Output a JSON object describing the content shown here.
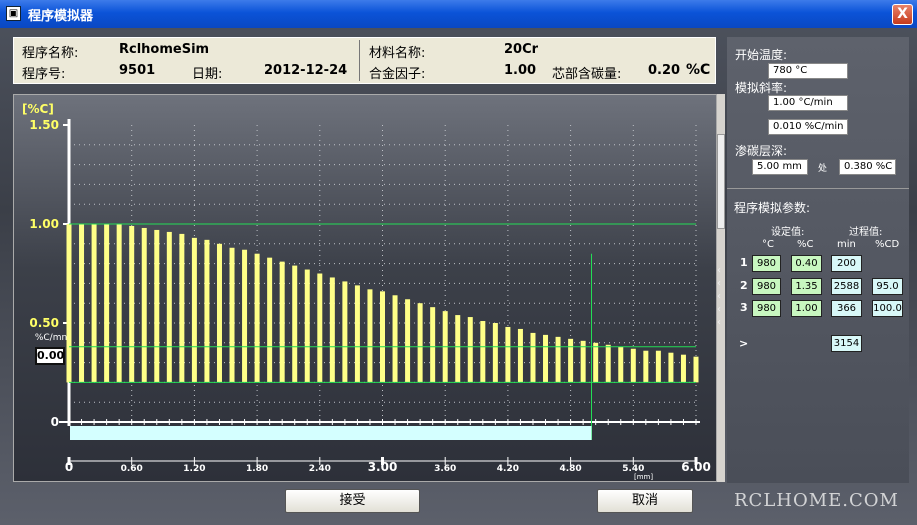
{
  "window": {
    "title": "程序模拟器",
    "close_label": "X",
    "icon_glyph": "▣"
  },
  "info": {
    "program_name_label": "程序名称:",
    "program_name": "RclhomeSim",
    "program_no_label": "程序号:",
    "program_no": "9501",
    "date_label": "日期:",
    "date": "2012-12-24",
    "material_label": "材料名称:",
    "material": "20Cr",
    "alloy_factor_label": "合金因子:",
    "alloy_factor": "1.00",
    "core_carbon_label": "芯部含碳量:",
    "core_carbon": "0.20",
    "core_carbon_unit": "%C"
  },
  "chart_rate": {
    "unit": "%C/mn",
    "value": "0.00"
  },
  "right_panel": {
    "start_temp_label": "开始温度:",
    "start_temp": "780 °C",
    "sim_slope_label": "模拟斜率:",
    "slope_temp": "1.00 °C/min",
    "slope_carbon": "0.010 %C/min",
    "case_depth_label": "渗碳层深:",
    "case_depth": "5.00 mm",
    "at_label": "处",
    "case_carbon": "0.380 %C",
    "params_title": "程序模拟参数:",
    "set_label": "设定值:",
    "proc_label": "过程值:",
    "col_c": "°C",
    "col_pc": "%C",
    "col_min": "min",
    "col_pcd": "%CD",
    "rows": [
      {
        "n": "1",
        "temp": "980",
        "carbon": "0.40",
        "min": "200",
        "cd": ""
      },
      {
        "n": "2",
        "temp": "980",
        "carbon": "1.35",
        "min": "2588",
        "cd": "95.0"
      },
      {
        "n": "3",
        "temp": "980",
        "carbon": "1.00",
        "min": "366",
        "cd": "100.0"
      }
    ],
    "total_arrow": ">",
    "total_min": "3154"
  },
  "buttons": {
    "accept": "接受",
    "cancel": "取消"
  },
  "watermark": "RCLHOME.COM",
  "colors": {
    "bar": "#ffff88",
    "ref_line": "#22dd55",
    "progress": "#d4ffff"
  },
  "chart_data": {
    "type": "bar",
    "title": "",
    "ylabel": "[%C]",
    "xlabel": "[mm]",
    "ylim": [
      0,
      1.5
    ],
    "xlim": [
      0,
      6.0
    ],
    "y_ticks": [
      "0",
      "0.50",
      "1.00",
      "1.50"
    ],
    "x_ticks": [
      "0",
      "0.60",
      "1.20",
      "1.80",
      "2.40",
      "3.00",
      "3.60",
      "4.20",
      "4.80",
      "5.40",
      "6.00"
    ],
    "grid": true,
    "x": [
      0.0,
      0.12,
      0.24,
      0.36,
      0.48,
      0.6,
      0.72,
      0.84,
      0.96,
      1.08,
      1.2,
      1.32,
      1.44,
      1.56,
      1.68,
      1.8,
      1.92,
      2.04,
      2.16,
      2.28,
      2.4,
      2.52,
      2.64,
      2.76,
      2.88,
      3.0,
      3.12,
      3.24,
      3.36,
      3.48,
      3.6,
      3.72,
      3.84,
      3.96,
      4.08,
      4.2,
      4.32,
      4.44,
      4.56,
      4.68,
      4.8,
      4.92,
      5.04,
      5.16,
      5.28,
      5.4,
      5.52,
      5.64,
      5.76,
      5.88,
      6.0
    ],
    "values": [
      1.0,
      1.0,
      1.0,
      1.0,
      1.0,
      0.99,
      0.98,
      0.97,
      0.96,
      0.95,
      0.93,
      0.92,
      0.9,
      0.88,
      0.87,
      0.85,
      0.83,
      0.81,
      0.79,
      0.77,
      0.75,
      0.73,
      0.71,
      0.69,
      0.67,
      0.66,
      0.64,
      0.62,
      0.6,
      0.58,
      0.56,
      0.54,
      0.53,
      0.51,
      0.5,
      0.48,
      0.47,
      0.45,
      0.44,
      0.43,
      0.42,
      0.41,
      0.4,
      0.39,
      0.38,
      0.37,
      0.36,
      0.36,
      0.35,
      0.34,
      0.33
    ],
    "baseline": 0.2,
    "ref_lines": [
      1.0,
      0.38,
      0.2
    ],
    "marker_x": 5.0,
    "progress_x": 5.0
  }
}
